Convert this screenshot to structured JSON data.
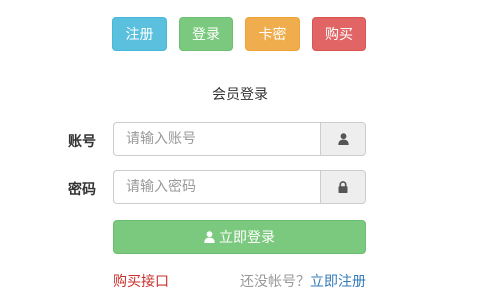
{
  "top_buttons": {
    "register": "注册",
    "login": "登录",
    "card": "卡密",
    "buy": "购买"
  },
  "form": {
    "title": "会员登录",
    "account_label": "账号",
    "account_placeholder": "请输入账号",
    "password_label": "密码",
    "password_placeholder": "请输入密码",
    "submit_label": "立即登录"
  },
  "footer": {
    "buy_link": "购买接口",
    "no_account_text": "还没帐号？",
    "register_link": "立即注册"
  },
  "icons": {
    "account_addon": "user-icon",
    "password_addon": "lock-icon",
    "submit": "user-icon"
  },
  "colors": {
    "info": "#5bc0de",
    "success": "#7bc97e",
    "warning": "#f0ad4e",
    "danger": "#e26565",
    "link_red": "#c9302c",
    "link_blue": "#337ab7"
  }
}
